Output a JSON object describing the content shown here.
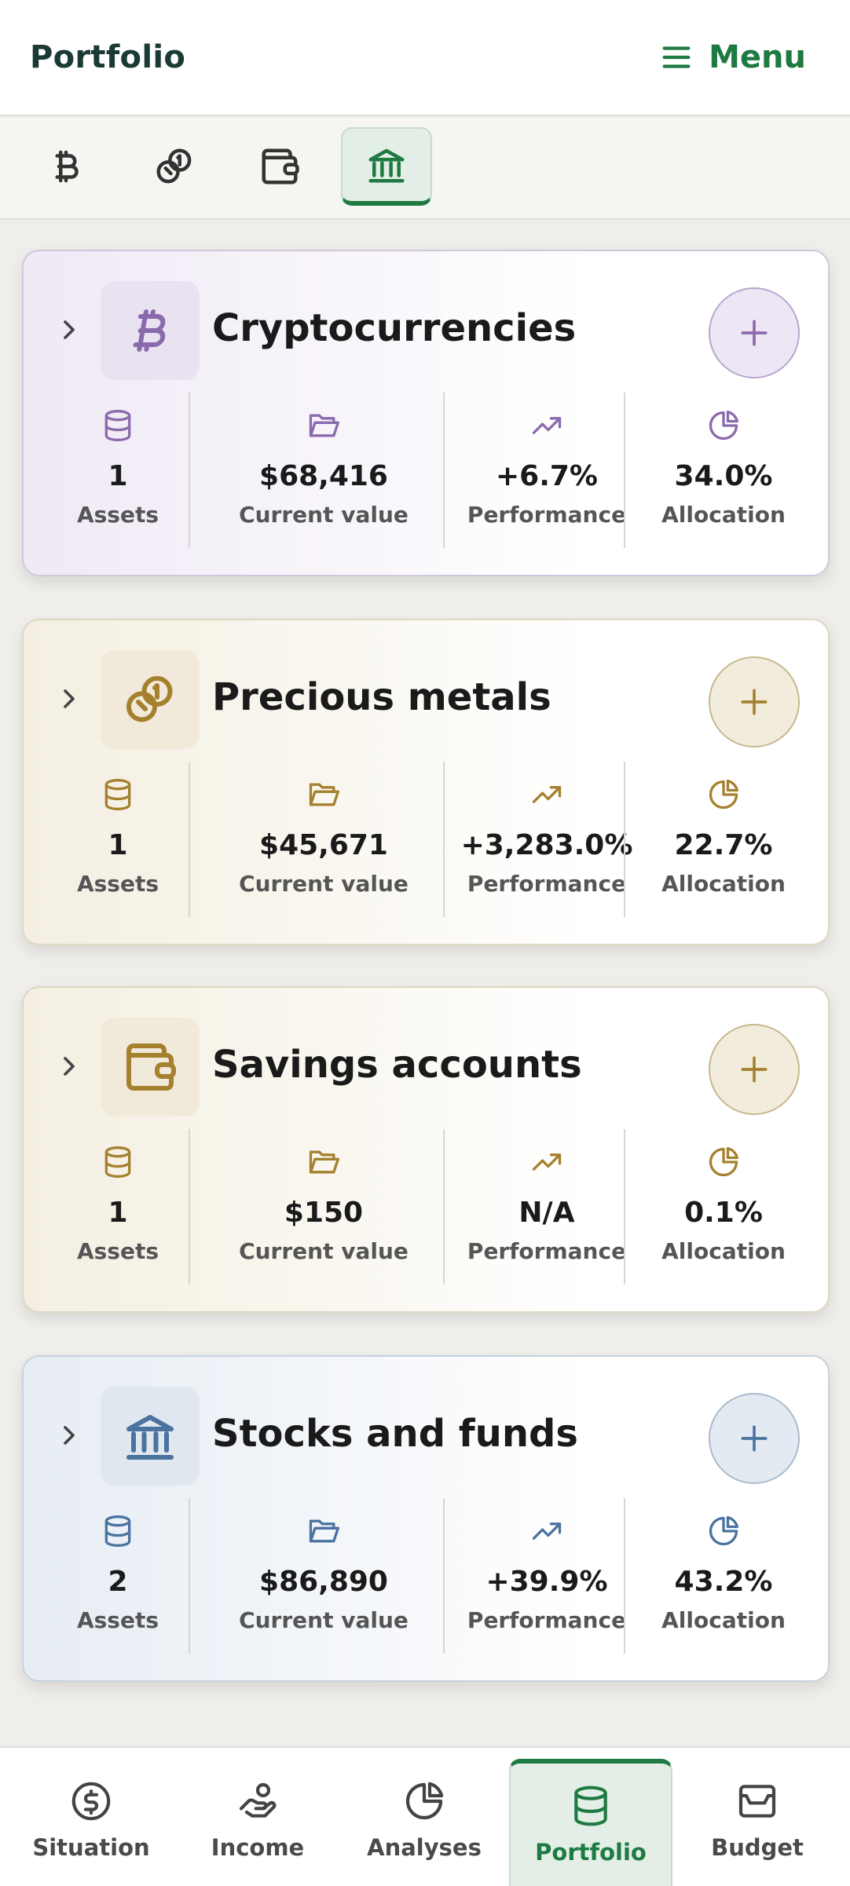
{
  "header": {
    "title": "Portfolio",
    "menu_label": "Menu"
  },
  "category_tabs": [
    {
      "icon": "bitcoin-icon",
      "active": false
    },
    {
      "icon": "coins-icon",
      "active": false
    },
    {
      "icon": "wallet-icon",
      "active": false
    },
    {
      "icon": "bank-icon",
      "active": true
    }
  ],
  "cards": [
    {
      "title": "Cryptocurrencies",
      "icon": "bitcoin-icon",
      "accent": "#8a6aad",
      "stats": {
        "assets": "1",
        "current_value": "$68,416",
        "performance": "+6.7%",
        "allocation": "34.0%"
      },
      "labels": {
        "assets": "Assets",
        "current_value": "Current value",
        "performance": "Performance",
        "allocation": "Allocation"
      }
    },
    {
      "title": "Precious metals",
      "icon": "coins-icon",
      "accent": "#a5812e",
      "stats": {
        "assets": "1",
        "current_value": "$45,671",
        "performance": "+3,283.0%",
        "allocation": "22.7%"
      },
      "labels": {
        "assets": "Assets",
        "current_value": "Current value",
        "performance": "Performance",
        "allocation": "Allocation"
      }
    },
    {
      "title": "Savings accounts",
      "icon": "wallet-icon",
      "accent": "#a5812e",
      "stats": {
        "assets": "1",
        "current_value": "$150",
        "performance": "N/A",
        "allocation": "0.1%"
      },
      "labels": {
        "assets": "Assets",
        "current_value": "Current value",
        "performance": "Performance",
        "allocation": "Allocation"
      }
    },
    {
      "title": "Stocks and funds",
      "icon": "bank-icon",
      "accent": "#4a73a0",
      "stats": {
        "assets": "2",
        "current_value": "$86,890",
        "performance": "+39.9%",
        "allocation": "43.2%"
      },
      "labels": {
        "assets": "Assets",
        "current_value": "Current value",
        "performance": "Performance",
        "allocation": "Allocation"
      }
    }
  ],
  "bottom_nav": [
    {
      "label": "Situation",
      "icon": "dollar-circle-icon",
      "active": false
    },
    {
      "label": "Income",
      "icon": "hand-coin-icon",
      "active": false
    },
    {
      "label": "Analyses",
      "icon": "pie-chart-icon",
      "active": false
    },
    {
      "label": "Portfolio",
      "icon": "database-icon",
      "active": true
    },
    {
      "label": "Budget",
      "icon": "inbox-icon",
      "active": false
    }
  ],
  "colors": {
    "brand_green": "#1e7a42",
    "crypto": "#8a6aad",
    "metals": "#a5812e",
    "stocks": "#4a73a0"
  }
}
